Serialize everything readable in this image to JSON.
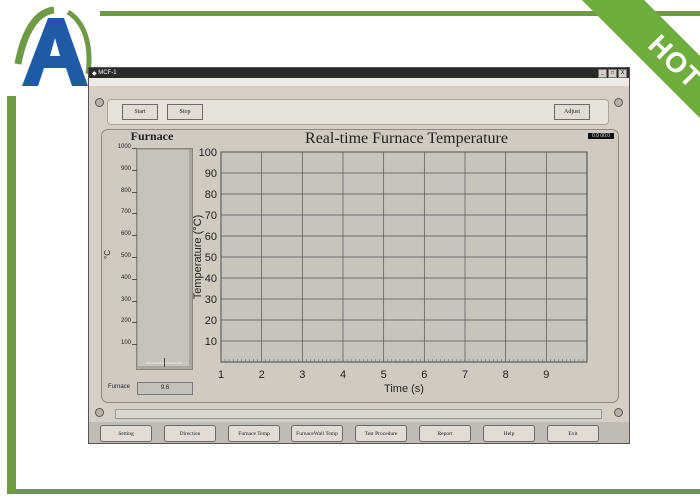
{
  "branding": {
    "logo_letter": "A",
    "ribbon_text": "HOT",
    "accent_color": "#6f9a45",
    "ribbon_color": "#6fae3e",
    "logo_color": "#1f5aa6"
  },
  "window": {
    "title": "MCF-1",
    "controls": [
      "_",
      "□",
      "X"
    ]
  },
  "toolbar": {
    "start_label": "Start",
    "stop_label": "Stop",
    "adjust_label": "Adjust"
  },
  "status_tag": "0.0 00.0",
  "gauge": {
    "title": "Furnace",
    "unit": "°C",
    "ticks": [
      "1000",
      "900",
      "800",
      "700",
      "600",
      "500",
      "400",
      "300",
      "200",
      "100"
    ],
    "readout_label": "Furnace",
    "readout_value": "9.6",
    "value": 9.6,
    "max": 1000
  },
  "chart_data": {
    "type": "line",
    "title": "Real-time Furnace Temperature",
    "xlabel": "Time (s)",
    "ylabel": "Temperature (°C)",
    "x_ticks": [
      "1",
      "2",
      "3",
      "4",
      "5",
      "6",
      "7",
      "8",
      "9"
    ],
    "y_ticks": [
      "100",
      "90",
      "80",
      "70",
      "60",
      "50",
      "40",
      "30",
      "20",
      "10"
    ],
    "xlim": [
      1,
      10
    ],
    "ylim": [
      0,
      100
    ],
    "grid": true,
    "series": [],
    "colors": {
      "background": "#c7c4be",
      "grid": "#555555"
    }
  },
  "nav_buttons": [
    "Setting",
    "Direction",
    "Furnace Temp",
    "FurnaceWall Temp",
    "Test Procedure",
    "Report",
    "Help",
    "Exit"
  ]
}
